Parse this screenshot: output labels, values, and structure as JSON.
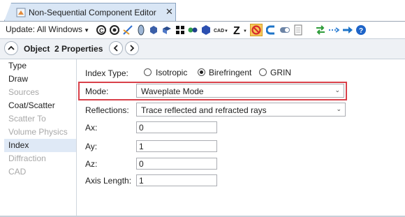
{
  "tab": {
    "title": "Non-Sequential Component Editor",
    "close": "✕"
  },
  "toolbar": {
    "update_label": "Update: All Windows",
    "cad_label": "CAD",
    "icons": [
      "refresh-icon",
      "refresh-all-icon",
      "ray-trace-icon",
      "lens-icon",
      "cube-icon",
      "object-icon",
      "grid-icon",
      "group-icon",
      "hexagon-icon",
      "cad-icon",
      "z-icon",
      "ignore-icon",
      "magnet-icon",
      "toggle-icon",
      "page-icon",
      "arrows-icon",
      "chain-icon",
      "arrow-right-icon",
      "help-icon"
    ]
  },
  "object_bar": {
    "object_label": "Object",
    "properties_label": "2 Properties"
  },
  "categories": [
    {
      "label": "Type",
      "state": "normal"
    },
    {
      "label": "Draw",
      "state": "normal"
    },
    {
      "label": "Sources",
      "state": "disabled"
    },
    {
      "label": "Coat/Scatter",
      "state": "normal"
    },
    {
      "label": "Scatter To",
      "state": "disabled"
    },
    {
      "label": "Volume Physics",
      "state": "disabled"
    },
    {
      "label": "Index",
      "state": "selected"
    },
    {
      "label": "Diffraction",
      "state": "disabled"
    },
    {
      "label": "CAD",
      "state": "disabled"
    }
  ],
  "form": {
    "index_type_label": "Index Type:",
    "index_options": [
      "Isotropic",
      "Birefringent",
      "GRIN"
    ],
    "index_selected": "Birefringent",
    "mode_label": "Mode:",
    "mode_value": "Waveplate Mode",
    "reflections_label": "Reflections:",
    "reflections_value": "Trace reflected and refracted rays",
    "ax_label": "Ax:",
    "ax_value": "0",
    "ay_label": "Ay:",
    "ay_value": "1",
    "az_label": "Az:",
    "az_value": "0",
    "axis_length_label": "Axis Length:",
    "axis_length_value": "1"
  },
  "colors": {
    "highlight": "#d9414a",
    "selected_bg": "#dfe9f6",
    "tab_bg": "#d9e6f5"
  }
}
